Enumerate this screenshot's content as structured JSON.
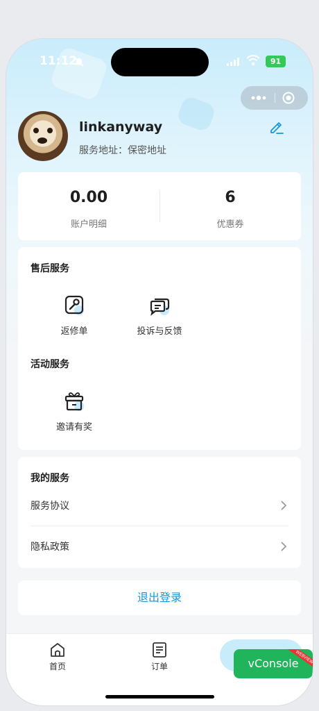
{
  "status_bar": {
    "time": "11:12",
    "battery": "91"
  },
  "profile": {
    "username": "linkanyway",
    "address": "服务地址：保密地址"
  },
  "stats": [
    {
      "value": "0.00",
      "label": "账户明细"
    },
    {
      "value": "6",
      "label": "优惠券"
    }
  ],
  "after_sales": {
    "title": "售后服务",
    "items": [
      {
        "label": "返修单",
        "icon": "wrench-icon"
      },
      {
        "label": "投诉与反馈",
        "icon": "chat-bubbles-icon"
      }
    ]
  },
  "activities": {
    "title": "活动服务",
    "items": [
      {
        "label": "邀请有奖",
        "icon": "gift-icon"
      }
    ]
  },
  "my_services": {
    "title": "我的服务",
    "rows": [
      {
        "label": "服务协议"
      },
      {
        "label": "隐私政策"
      }
    ]
  },
  "logout_label": "退出登录",
  "tabs": [
    {
      "label": "首页",
      "icon": "home-icon"
    },
    {
      "label": "订单",
      "icon": "order-icon"
    }
  ],
  "vconsole": {
    "label": "vConsole",
    "ribbon": "WEBVIEW"
  },
  "colors": {
    "accent": "#1597e5",
    "vconsole": "#20b55a",
    "battery": "#34c759"
  }
}
